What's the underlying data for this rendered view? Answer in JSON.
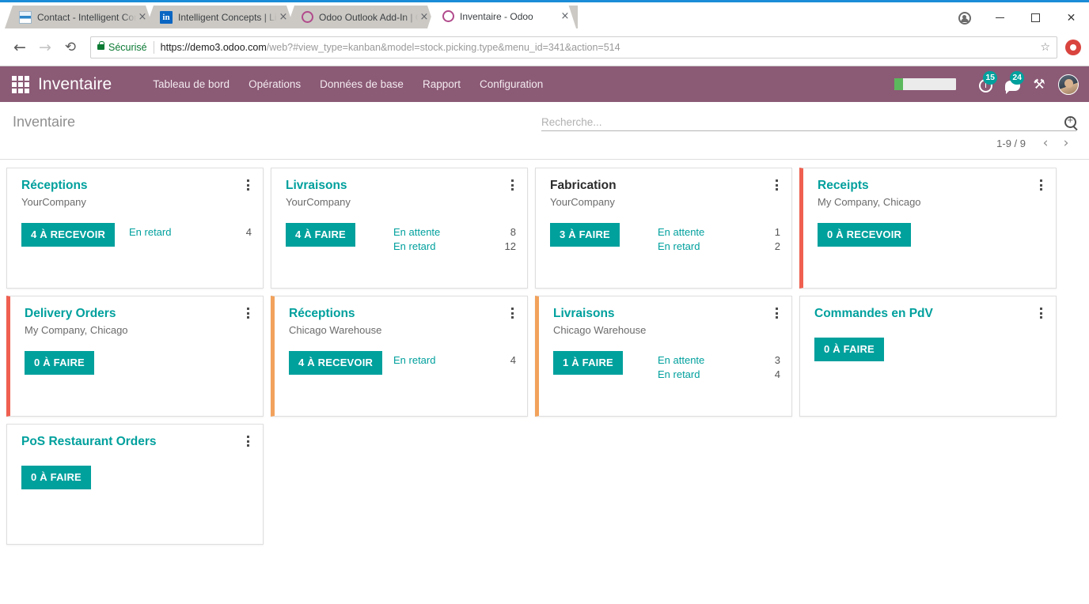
{
  "browser": {
    "tabs": [
      {
        "title": "Contact - Intelligent Con",
        "favicon": "contact-favicon",
        "active": false,
        "close_label": "×"
      },
      {
        "title": "Intelligent Concepts | Lin",
        "favicon": "linkedin-favicon",
        "favicon_text": "in",
        "active": false,
        "close_label": "×"
      },
      {
        "title": "Odoo Outlook Add-In | O",
        "favicon": "odoo-favicon",
        "active": false,
        "close_label": "×"
      },
      {
        "title": "Inventaire - Odoo",
        "favicon": "odoo-favicon",
        "active": true,
        "close_label": "×"
      }
    ],
    "window_controls": {
      "profile": "profile-icon",
      "minimize": "—",
      "maximize": "□",
      "close": "✕"
    },
    "toolbar": {
      "back": "←",
      "forward": "→",
      "reload": "⟳",
      "secure_label": "Sécurisé",
      "url_host": "https://demo3.odoo.com",
      "url_path": "/web?#view_type=kanban&model=stock.picking.type&menu_id=341&action=514",
      "bookmark": "☆"
    }
  },
  "navbar": {
    "apps_menu": "apps-grid-icon",
    "brand": "Inventaire",
    "menus": [
      {
        "label": "Tableau de bord"
      },
      {
        "label": "Opérations"
      },
      {
        "label": "Données de base"
      },
      {
        "label": "Rapport"
      },
      {
        "label": "Configuration"
      }
    ],
    "progress_percent": 14,
    "activities_badge": "15",
    "messages_badge": "24",
    "tools_icon": "⚒",
    "user_avatar": "user-avatar"
  },
  "control_panel": {
    "title": "Inventaire",
    "search_placeholder": "Recherche...",
    "search_value": "",
    "pager_count": "1-9 / 9",
    "pager_prev": "‹",
    "pager_next": "›"
  },
  "colors": {
    "navbar_bg": "#8b5a75",
    "primary": "#00a09d",
    "accent_red": "#f06050",
    "accent_orange": "#f2a25c"
  },
  "kanban": {
    "cards": [
      {
        "title": "Réceptions",
        "title_style": "teal",
        "subtitle": "YourCompany",
        "button": "4 À RECEVOIR",
        "accent": "none",
        "stats": [
          {
            "label": "En retard",
            "value": "4"
          }
        ]
      },
      {
        "title": "Livraisons",
        "title_style": "teal",
        "subtitle": "YourCompany",
        "button": "4 À FAIRE",
        "accent": "none",
        "stats": [
          {
            "label": "En attente",
            "value": "8"
          },
          {
            "label": "En retard",
            "value": "12"
          }
        ]
      },
      {
        "title": "Fabrication",
        "title_style": "dark",
        "subtitle": "YourCompany",
        "button": "3 À FAIRE",
        "accent": "none",
        "stats": [
          {
            "label": "En attente",
            "value": "1"
          },
          {
            "label": "En retard",
            "value": "2"
          }
        ]
      },
      {
        "title": "Receipts",
        "title_style": "teal",
        "subtitle": "My Company, Chicago",
        "button": "0 À RECEVOIR",
        "accent": "red",
        "stats": []
      },
      {
        "title": "Delivery Orders",
        "title_style": "teal",
        "subtitle": "My Company, Chicago",
        "button": "0 À FAIRE",
        "accent": "red",
        "stats": []
      },
      {
        "title": "Réceptions",
        "title_style": "teal",
        "subtitle": "Chicago Warehouse",
        "button": "4 À RECEVOIR",
        "accent": "orange",
        "stats": [
          {
            "label": "En retard",
            "value": "4"
          }
        ]
      },
      {
        "title": "Livraisons",
        "title_style": "teal",
        "subtitle": "Chicago Warehouse",
        "button": "1 À FAIRE",
        "accent": "orange",
        "stats": [
          {
            "label": "En attente",
            "value": "3"
          },
          {
            "label": "En retard",
            "value": "4"
          }
        ]
      },
      {
        "title": "Commandes en PdV",
        "title_style": "teal",
        "subtitle": "",
        "button": "0 À FAIRE",
        "accent": "none",
        "stats": []
      },
      {
        "title": "PoS Restaurant Orders",
        "title_style": "teal",
        "subtitle": "",
        "button": "0 À FAIRE",
        "accent": "none",
        "stats": []
      }
    ]
  }
}
